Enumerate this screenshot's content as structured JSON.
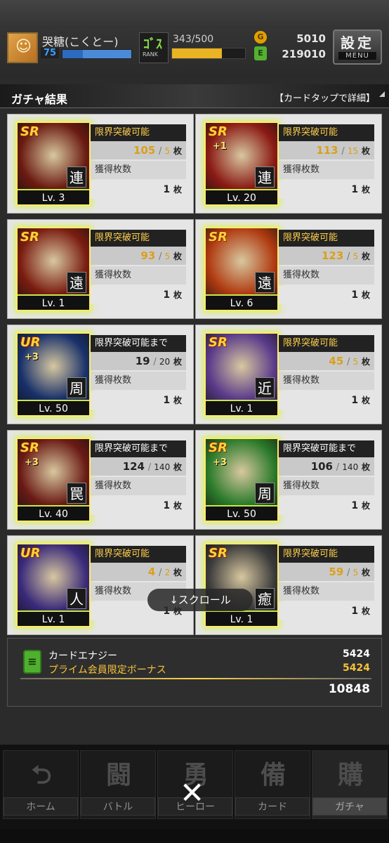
{
  "header": {
    "player_name": "哭糖(こくとー)",
    "level": "75",
    "rank_icon_text": "RANK",
    "rank_icon_big": "ｺﾞｽ",
    "stamina": "343/500",
    "stamina_fraction": 0.686,
    "coin_icon": "coin-icon",
    "coins": "5010",
    "energy": "219010",
    "settings_label": "設定",
    "settings_sub": "MENU"
  },
  "section": {
    "title": "ガチャ結果",
    "hint": "【カードタップで詳細】"
  },
  "cards": [
    {
      "rarity": "SR",
      "plus": "",
      "type": "連",
      "level": "Lv. 3",
      "head": "限界突破可能",
      "have": "105",
      "need": "5",
      "unit": "枚",
      "label": "獲得枚数",
      "got": "1",
      "got_unit": "枚",
      "reachable": true,
      "art": "#6a1a10"
    },
    {
      "rarity": "SR",
      "plus": "+1",
      "type": "連",
      "level": "Lv. 20",
      "head": "限界突破可能",
      "have": "113",
      "need": "15",
      "unit": "枚",
      "label": "獲得枚数",
      "got": "1",
      "got_unit": "枚",
      "reachable": true,
      "art": "#8a1a14"
    },
    {
      "rarity": "SR",
      "plus": "",
      "type": "遠",
      "level": "Lv. 1",
      "head": "限界突破可能",
      "have": "93",
      "need": "5",
      "unit": "枚",
      "label": "獲得枚数",
      "got": "1",
      "got_unit": "枚",
      "reachable": true,
      "art": "#7a1c10"
    },
    {
      "rarity": "SR",
      "plus": "",
      "type": "遠",
      "level": "Lv. 6",
      "head": "限界突破可能",
      "have": "123",
      "need": "5",
      "unit": "枚",
      "label": "獲得枚数",
      "got": "1",
      "got_unit": "枚",
      "reachable": true,
      "art": "#b03a10"
    },
    {
      "rarity": "UR",
      "plus": "+3",
      "type": "周",
      "level": "Lv. 50",
      "head": "限界突破可能まで",
      "have": "19",
      "need": "20",
      "unit": "枚",
      "label": "獲得枚数",
      "got": "1",
      "got_unit": "枚",
      "reachable": false,
      "art": "#18306a"
    },
    {
      "rarity": "SR",
      "plus": "",
      "type": "近",
      "level": "Lv. 1",
      "head": "限界突破可能",
      "have": "45",
      "need": "5",
      "unit": "枚",
      "label": "獲得枚数",
      "got": "1",
      "got_unit": "枚",
      "reachable": true,
      "art": "#5a3a8a"
    },
    {
      "rarity": "SR",
      "plus": "+3",
      "type": "罠",
      "level": "Lv. 40",
      "head": "限界突破可能まで",
      "have": "124",
      "need": "140",
      "unit": "枚",
      "label": "獲得枚数",
      "got": "1",
      "got_unit": "枚",
      "reachable": false,
      "art": "#6a1a14"
    },
    {
      "rarity": "SR",
      "plus": "+3",
      "type": "周",
      "level": "Lv. 50",
      "head": "限界突破可能まで",
      "have": "106",
      "need": "140",
      "unit": "枚",
      "label": "獲得枚数",
      "got": "1",
      "got_unit": "枚",
      "reachable": false,
      "art": "#2a7a2a"
    },
    {
      "rarity": "UR",
      "plus": "",
      "type": "人",
      "level": "Lv. 1",
      "head": "限界突破可能",
      "have": "4",
      "need": "2",
      "unit": "枚",
      "label": "獲得枚数",
      "got": "1",
      "got_unit": "枚",
      "reachable": true,
      "art": "#3a2a7a"
    },
    {
      "rarity": "SR",
      "plus": "",
      "type": "癒",
      "level": "Lv. 1",
      "head": "限界突破可能",
      "have": "59",
      "need": "5",
      "unit": "枚",
      "label": "獲得枚数",
      "got": "1",
      "got_unit": "枚",
      "reachable": true,
      "art": "#3a3a3a"
    }
  ],
  "scroll_hint": "↓スクロール",
  "energy_summary": {
    "icon": "energy-can-icon",
    "row1_label": "カードエナジー",
    "row1_value": "5424",
    "row2_label": "プライム会員限定ボーナス",
    "row2_value": "5424",
    "total": "10848"
  },
  "nav": [
    {
      "label": "ホーム",
      "icon": "⮌",
      "active": false
    },
    {
      "label": "バトル",
      "icon": "闘",
      "active": false
    },
    {
      "label": "ヒーロー",
      "icon": "勇",
      "active": false
    },
    {
      "label": "カード",
      "icon": "備",
      "active": false
    },
    {
      "label": "ガチャ",
      "icon": "購",
      "active": true
    }
  ],
  "close_label": "✕"
}
